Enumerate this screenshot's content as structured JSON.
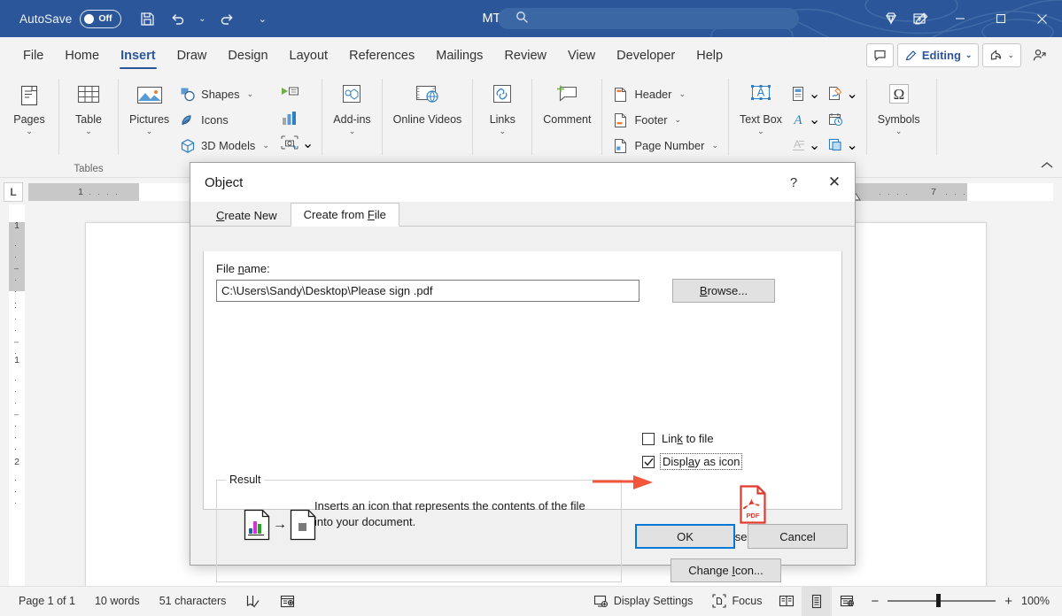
{
  "titlebar": {
    "autosave_label": "AutoSave",
    "autosave_state": "Off",
    "document_name": "MTEDocument",
    "icons": [
      "save-icon",
      "undo-icon",
      "redo-icon",
      "customize-quick-access-icon"
    ],
    "search_placeholder": "",
    "right_icons": [
      "diamond-icon",
      "pen-icon",
      "ribbon-display-options-icon"
    ],
    "window_buttons": [
      "minimize",
      "maximize",
      "close"
    ],
    "accent_color": "#2b579a"
  },
  "ribbon_tabs": {
    "items": [
      {
        "label": "File",
        "active": false
      },
      {
        "label": "Home",
        "active": false
      },
      {
        "label": "Insert",
        "active": true
      },
      {
        "label": "Draw",
        "active": false
      },
      {
        "label": "Design",
        "active": false
      },
      {
        "label": "Layout",
        "active": false
      },
      {
        "label": "References",
        "active": false
      },
      {
        "label": "Mailings",
        "active": false
      },
      {
        "label": "Review",
        "active": false
      },
      {
        "label": "View",
        "active": false
      },
      {
        "label": "Developer",
        "active": false
      },
      {
        "label": "Help",
        "active": false
      }
    ],
    "right": {
      "comment_label": "",
      "editing_label": "Editing",
      "share_label": "",
      "people_label": ""
    }
  },
  "ribbon": {
    "groups": [
      {
        "name": "pages",
        "label": "",
        "big_buttons": [
          {
            "label": "Pages",
            "icon": "pages-icon",
            "has_chevron": true
          }
        ]
      },
      {
        "name": "tables",
        "label": "Tables",
        "big_buttons": [
          {
            "label": "Table",
            "icon": "table-icon",
            "has_chevron": true
          }
        ]
      },
      {
        "name": "illustrations",
        "label": "",
        "big_buttons": [
          {
            "label": "Pictures",
            "icon": "pictures-icon",
            "has_chevron": true
          }
        ],
        "small_buttons": [
          {
            "label": "Shapes",
            "icon": "shapes-icon",
            "has_chevron": true
          },
          {
            "label": "Icons",
            "icon": "icons-icon",
            "has_chevron": false
          },
          {
            "label": "3D Models",
            "icon": "3d-models-icon",
            "has_chevron": true
          }
        ],
        "icon_cells": [
          {
            "icon": "smartart-icon",
            "has_chevron": false
          },
          {
            "icon": "chart-icon",
            "has_chevron": false
          },
          {
            "icon": "screenshot-icon",
            "has_chevron": true
          }
        ]
      },
      {
        "name": "add-ins",
        "label": "",
        "big_buttons": [
          {
            "label": "Add-ins",
            "icon": "add-ins-icon",
            "has_chevron": true
          }
        ]
      },
      {
        "name": "media",
        "label": "",
        "big_buttons": [
          {
            "label": "Online Videos",
            "icon": "online-videos-icon",
            "has_chevron": false
          }
        ]
      },
      {
        "name": "links",
        "label": "",
        "big_buttons": [
          {
            "label": "Links",
            "icon": "links-icon",
            "has_chevron": true
          }
        ]
      },
      {
        "name": "comments",
        "label": "",
        "big_buttons": [
          {
            "label": "Comment",
            "icon": "comment-icon",
            "has_chevron": false
          }
        ]
      },
      {
        "name": "header-footer",
        "label": "",
        "small_buttons": [
          {
            "label": "Header",
            "icon": "header-icon",
            "has_chevron": true
          },
          {
            "label": "Footer",
            "icon": "footer-icon",
            "has_chevron": true
          },
          {
            "label": "Page Number",
            "icon": "page-number-icon",
            "has_chevron": true
          }
        ]
      },
      {
        "name": "text",
        "label": "",
        "big_buttons": [
          {
            "label": "Text Box",
            "icon": "text-box-icon",
            "has_chevron": true
          }
        ],
        "icon_cells": [
          {
            "icon": "quick-parts-icon",
            "has_chevron": true
          },
          {
            "icon": "wordart-icon",
            "has_chevron": true
          },
          {
            "icon": "drop-cap-icon",
            "has_chevron": true
          },
          {
            "icon": "signature-line-icon",
            "has_chevron": true
          },
          {
            "icon": "date-time-icon",
            "has_chevron": false
          },
          {
            "icon": "object-icon",
            "has_chevron": true
          }
        ]
      },
      {
        "name": "symbols",
        "label": "",
        "big_buttons": [
          {
            "label": "Symbols",
            "icon": "omega-icon",
            "has_chevron": true
          }
        ]
      }
    ]
  },
  "rulers": {
    "tab_selector": "L",
    "horizontal_marks": [
      "1",
      "1",
      "7"
    ],
    "vertical_marks": [
      "1",
      "1",
      "2"
    ]
  },
  "dialog": {
    "title": "Object",
    "help_glyph": "?",
    "close_glyph": "✕",
    "tabs": [
      {
        "label": "Create New",
        "accel": "C",
        "active": false
      },
      {
        "label": "Create from File",
        "accel": "F",
        "active": true
      }
    ],
    "file_name_label": "File name:",
    "file_name_accel": "n",
    "file_name_value": "C:\\Users\\Sandy\\Desktop\\Please sign .pdf",
    "browse_label": "Browse...",
    "browse_accel": "B",
    "checkboxes": [
      {
        "label": "Link to file",
        "accel": "k",
        "checked": false,
        "focused": false
      },
      {
        "label": "Display as icon",
        "accel": "y",
        "checked": true,
        "focused": true
      }
    ],
    "result_legend": "Result",
    "result_text": "Inserts an icon that represents the contents of the file into your document.",
    "preview": {
      "icon": "pdf-file-icon",
      "file_label": "Please sign .pdf"
    },
    "change_icon_label": "Change Icon...",
    "change_icon_accel": "I",
    "ok_label": "OK",
    "cancel_label": "Cancel",
    "annotation_arrow_color": "#f4553d"
  },
  "statusbar": {
    "page_text": "Page 1 of 1",
    "words_text": "10 words",
    "characters_text": "51 characters",
    "proofing_icon": "proofing-errors-icon",
    "accessibility_icon": "accessibility-checker-icon",
    "display_settings_label": "Display Settings",
    "focus_label": "Focus",
    "views": [
      {
        "name": "read-mode",
        "selected": false
      },
      {
        "name": "print-layout",
        "selected": true
      },
      {
        "name": "web-layout",
        "selected": false
      }
    ],
    "zoom_value": "100%"
  }
}
